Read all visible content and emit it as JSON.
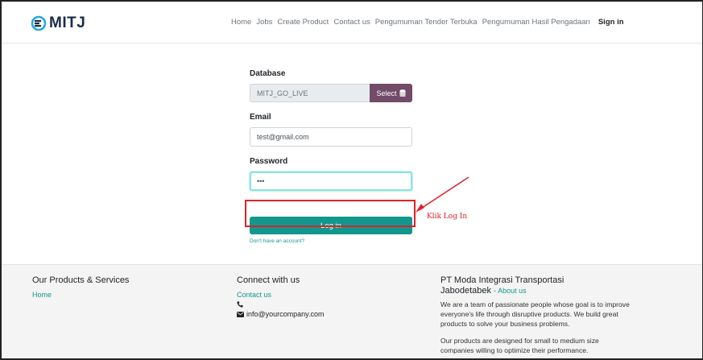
{
  "brand": {
    "logo_text": "MITJ"
  },
  "nav": {
    "items": [
      "Home",
      "Jobs",
      "Create Product",
      "Contact us",
      "Pengumuman Tender Terbuka",
      "Pengumuman Hasil Pengadaan"
    ],
    "sign_in": "Sign in"
  },
  "form": {
    "database_label": "Database",
    "database_value": "MITJ_GO_LIVE",
    "select_button": "Select",
    "email_label": "Email",
    "email_value": "test@gmail.com",
    "password_label": "Password",
    "password_value": "•••",
    "login_button": "Log in",
    "no_account_link": "Don't have an account?"
  },
  "annotation": {
    "text": "Klik Log In",
    "color": "#e0202a"
  },
  "footer": {
    "col1": {
      "title": "Our Products & Services",
      "link": "Home"
    },
    "col2": {
      "title": "Connect with us",
      "contact_link": "Contact us",
      "email": "info@yourcompany.com"
    },
    "col3": {
      "title_line1": "PT Moda Integrasi Transportasi",
      "title_line2": "Jabodetabek",
      "about_link": "About us",
      "para1": "We are a team of passionate people whose goal is to improve everyone's life through disruptive products. We build great products to solve your business problems.",
      "para2": "Our products are designed for small to medium size companies willing to optimize their performance."
    }
  },
  "colors": {
    "primary": "#12978d",
    "select_button": "#714b67",
    "brand_dark": "#1b2d49"
  }
}
